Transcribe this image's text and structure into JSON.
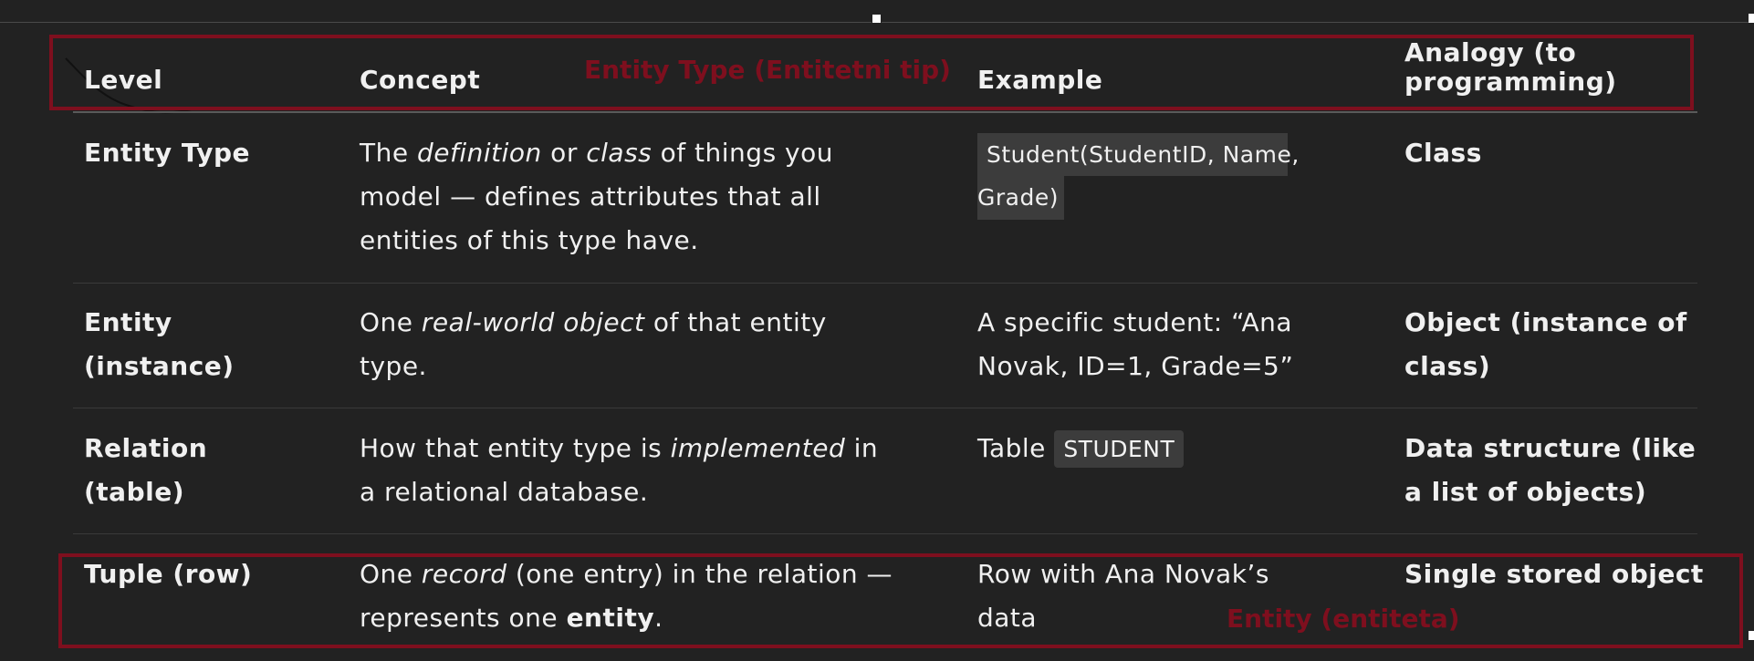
{
  "headers": {
    "level": "Level",
    "concept": "Concept",
    "example": "Example",
    "analogy_line1": "Analogy (to",
    "analogy_line2": "programming)"
  },
  "annotations": {
    "top": "Entity Type (Entitetni tip)",
    "bottom": "Entity (entiteta)",
    "color": "#7e0f1e"
  },
  "rows": [
    {
      "level": "Entity Type",
      "concept": {
        "a": "The ",
        "b": "definition",
        "c": " or ",
        "d": "class",
        "e": " of things you",
        "line2": "model — defines attributes that all",
        "line3": "entities of this type have."
      },
      "example": {
        "code_line1": "Student(StudentID, Name,",
        "code_line2": "Grade)"
      },
      "analogy": "Class"
    },
    {
      "level_line1": "Entity",
      "level_line2": "(instance)",
      "concept": {
        "a": "One ",
        "b": "real-world object",
        "c": " of that entity",
        "line2": "type."
      },
      "example": {
        "line1": "A specific student: “Ana",
        "line2": "Novak, ID=1, Grade=5”"
      },
      "analogy_line1": "Object (instance of",
      "analogy_line2": "class)"
    },
    {
      "level_line1": "Relation",
      "level_line2": "(table)",
      "concept": {
        "a": "How that entity type is ",
        "b": "implemented",
        "c": " in",
        "line2": "a relational database."
      },
      "example": {
        "prefix": "Table",
        "code": "STUDENT"
      },
      "analogy_line1": "Data structure (like",
      "analogy_line2": "a list of objects)"
    },
    {
      "level": "Tuple (row)",
      "concept": {
        "a": "One ",
        "b": "record",
        "c": " (one entry) in the relation —",
        "line2a": "represents one ",
        "line2b": "entity",
        "line2c": "."
      },
      "example": {
        "line1": "Row with Ana Novak’s",
        "line2": "data"
      },
      "analogy": "Single stored object"
    }
  ]
}
